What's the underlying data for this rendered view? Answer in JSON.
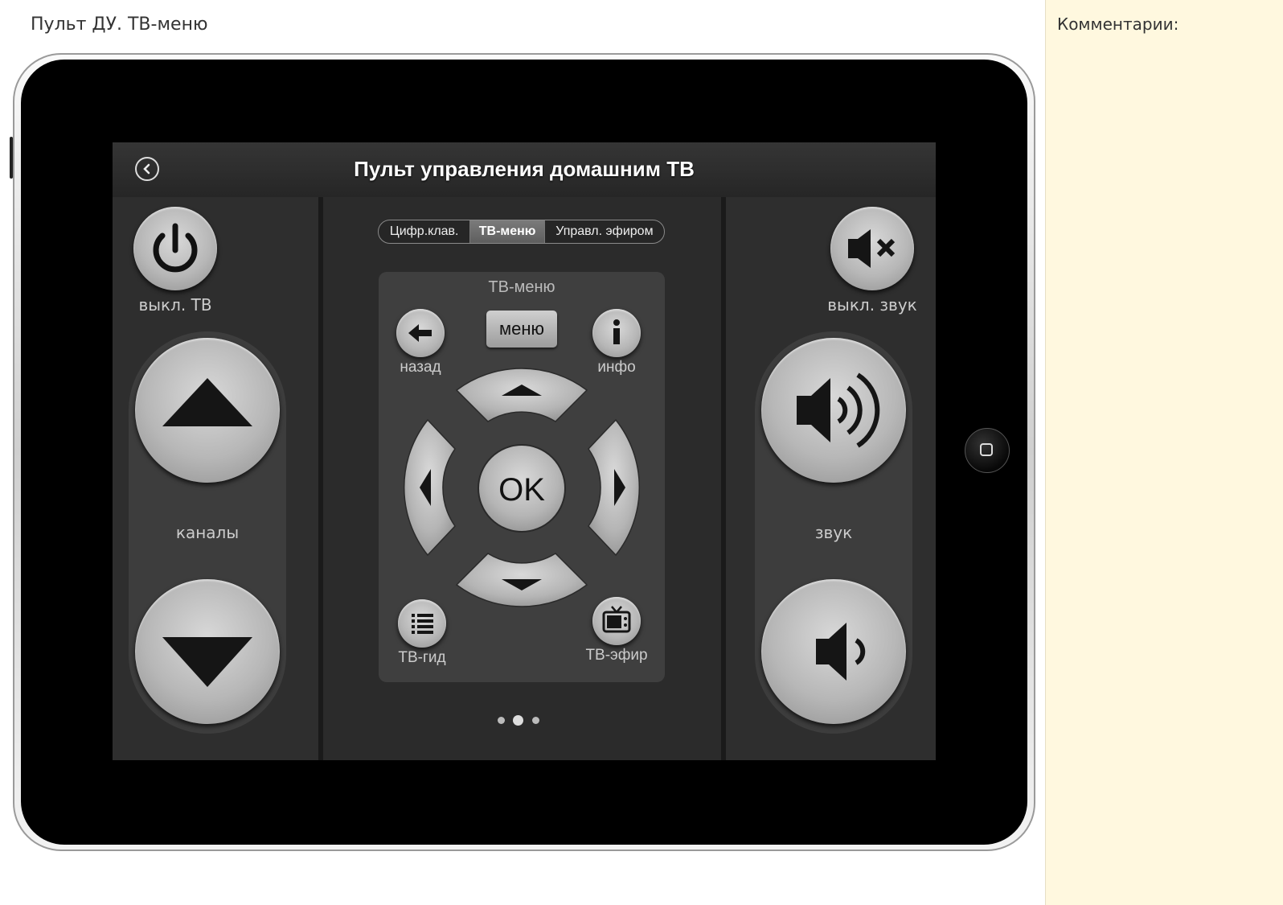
{
  "page": {
    "title": "Пульт ДУ. ТВ-меню"
  },
  "comments": {
    "label": "Комментарии:"
  },
  "app": {
    "title": "Пульт управления домашним ТВ",
    "power": {
      "label": "выкл. ТВ"
    },
    "mute": {
      "label": "выкл. звук"
    },
    "channels": {
      "label": "каналы"
    },
    "volume": {
      "label": "звук"
    },
    "tabs": [
      {
        "label": "Цифр.клав.",
        "active": false
      },
      {
        "label": "ТВ-меню",
        "active": true
      },
      {
        "label": "Управл. эфиром",
        "active": false
      }
    ],
    "tv_menu": {
      "title": "ТВ-меню",
      "menu_label": "меню",
      "back_label": "назад",
      "info_label": "инфо",
      "ok_label": "OK",
      "guide_label": "ТВ-гид",
      "live_label": "ТВ-эфир"
    },
    "pager": {
      "count": 3,
      "active": 2
    }
  },
  "colors": {
    "accent": "#b9b9b9",
    "screen_bg": "#2a2a2a",
    "comments_bg": "#fff8df"
  }
}
